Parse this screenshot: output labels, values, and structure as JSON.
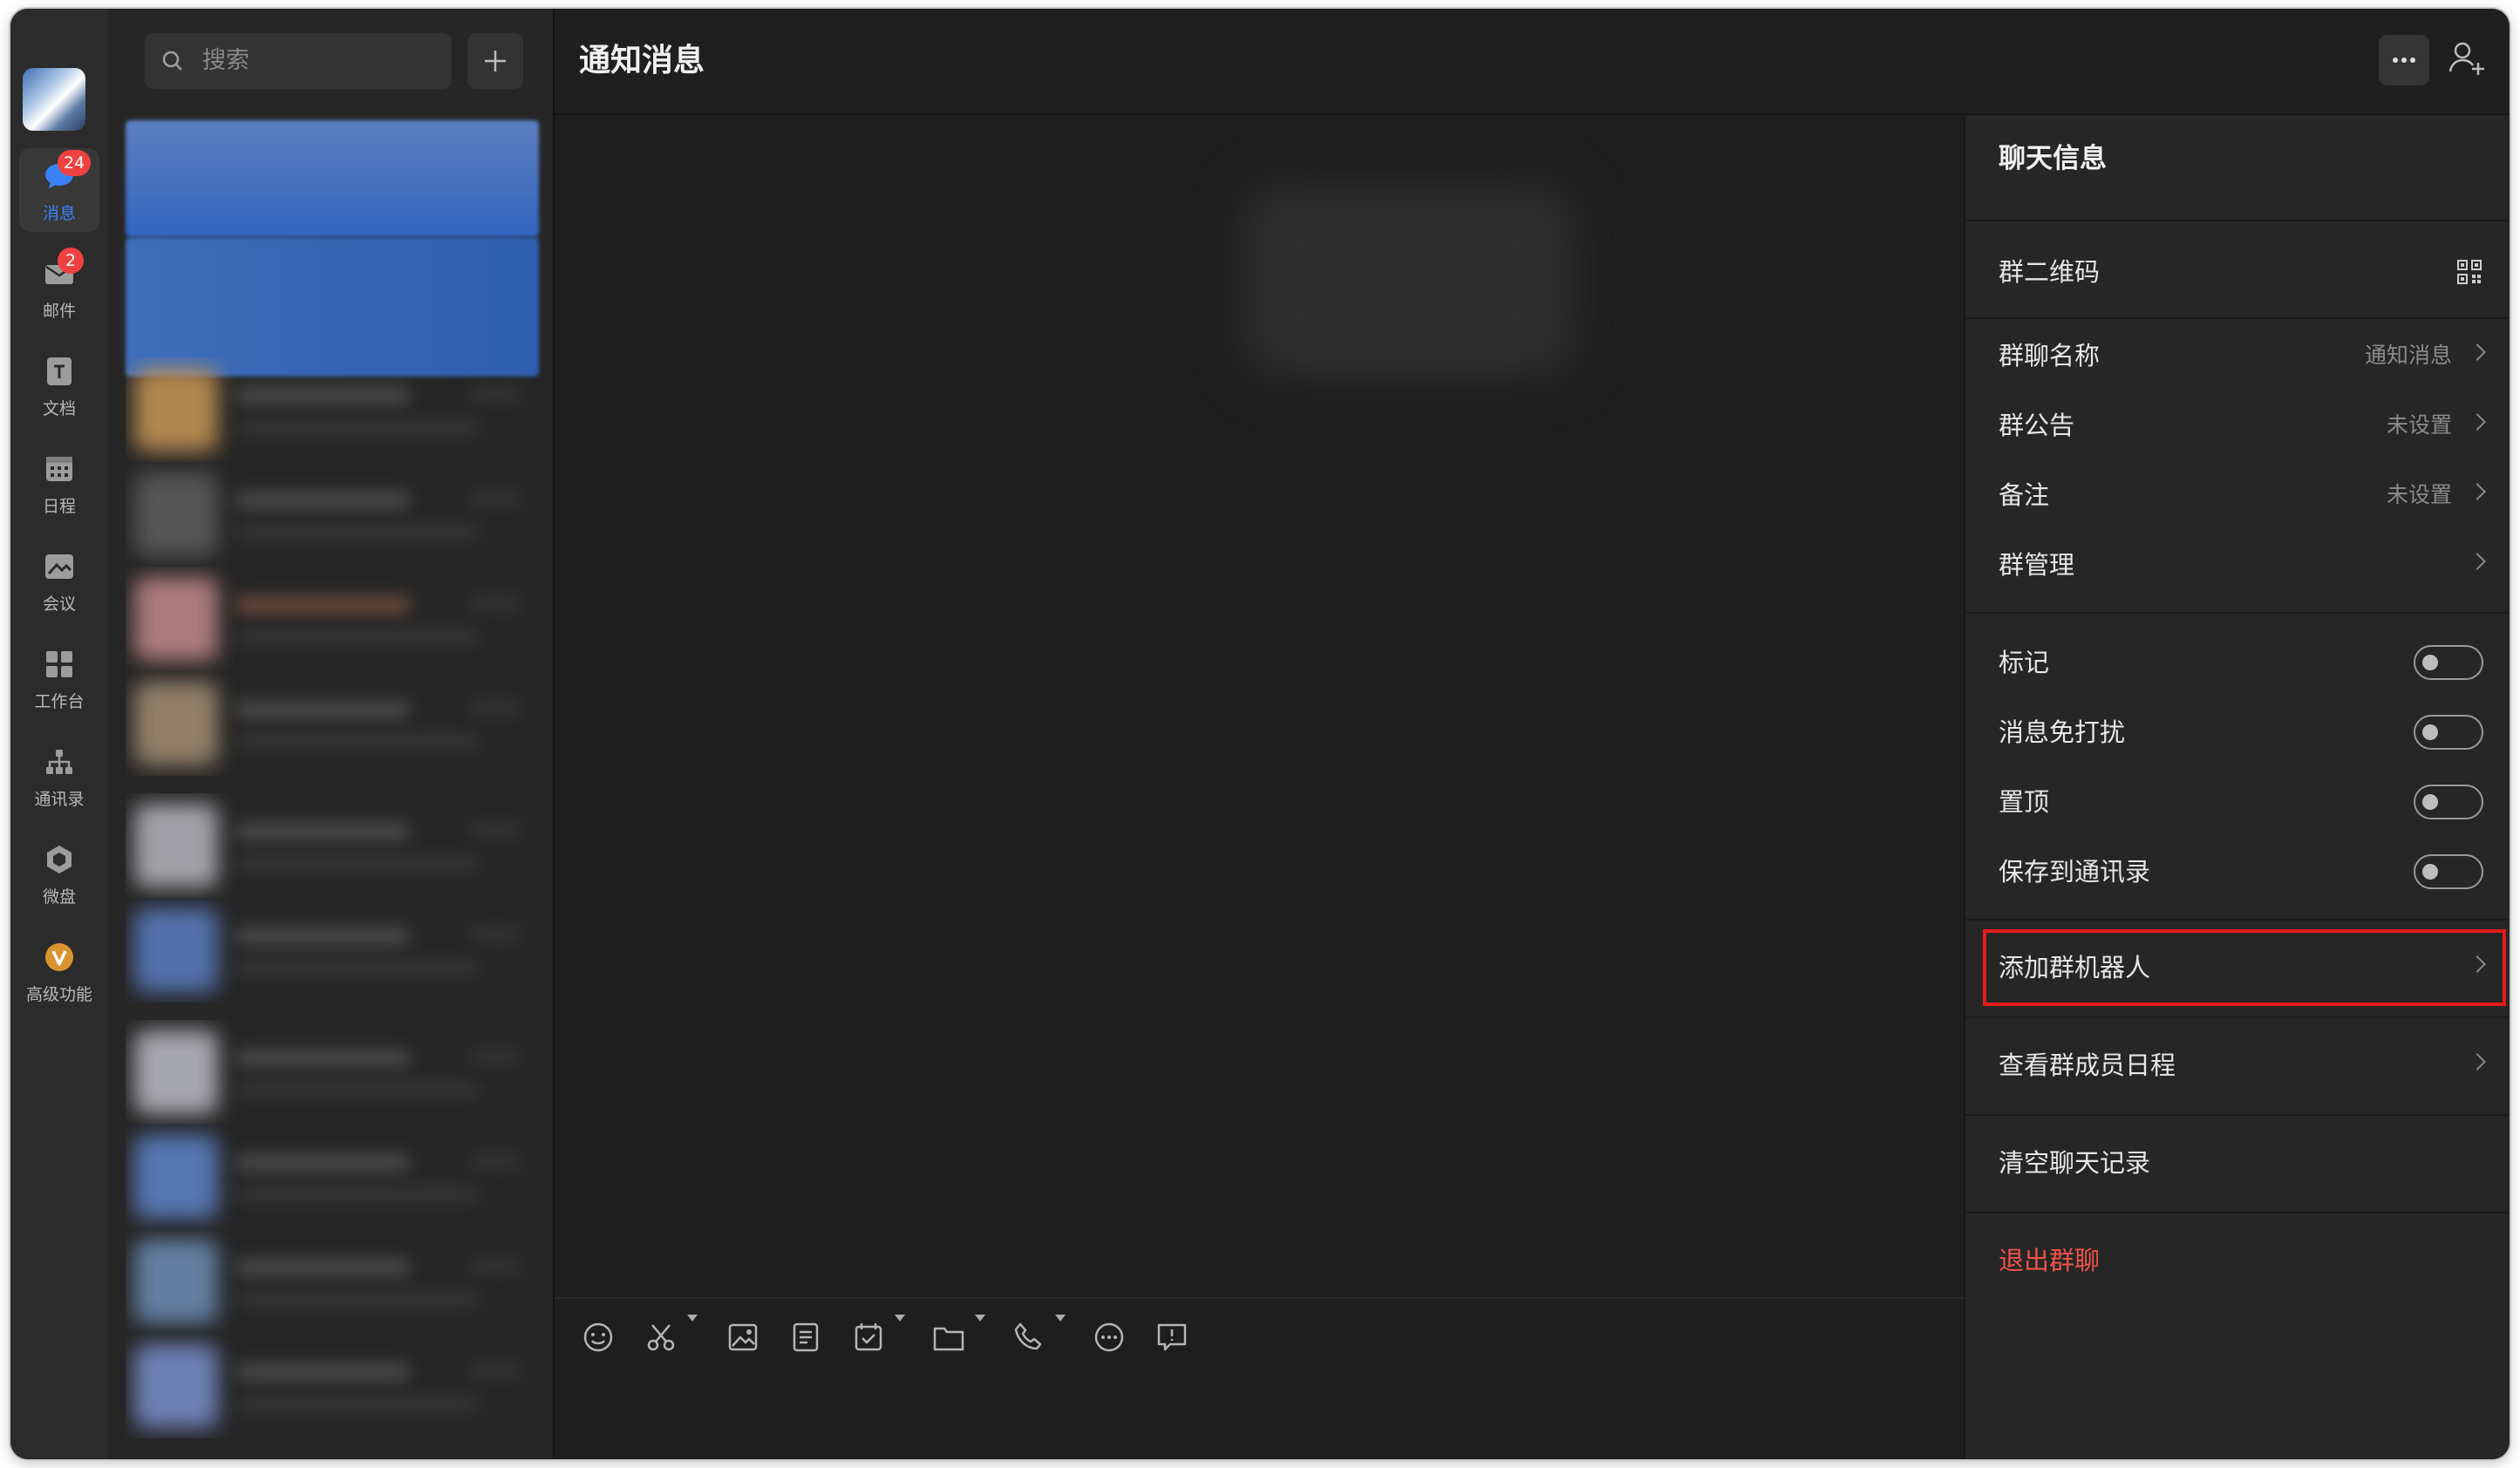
{
  "nav": {
    "items": [
      {
        "label": "消息",
        "badge": "24",
        "icon": "chat-bubble-icon",
        "active": true
      },
      {
        "label": "邮件",
        "badge": "2",
        "icon": "mail-icon"
      },
      {
        "label": "文档",
        "icon": "document-icon"
      },
      {
        "label": "日程",
        "icon": "calendar-icon"
      },
      {
        "label": "会议",
        "icon": "meeting-icon"
      },
      {
        "label": "工作台",
        "icon": "workbench-icon"
      },
      {
        "label": "通讯录",
        "icon": "contacts-icon"
      },
      {
        "label": "微盘",
        "icon": "drive-icon"
      },
      {
        "label": "高级功能",
        "icon": "premium-icon"
      }
    ]
  },
  "search": {
    "placeholder": "搜索"
  },
  "chat": {
    "title": "通知消息"
  },
  "panel": {
    "title": "聊天信息",
    "qr_label": "群二维码",
    "group_name": {
      "label": "群聊名称",
      "value": "通知消息"
    },
    "announcement": {
      "label": "群公告",
      "value": "未设置"
    },
    "remark": {
      "label": "备注",
      "value": "未设置"
    },
    "manage": {
      "label": "群管理"
    },
    "toggles": [
      {
        "label": "标记",
        "on": false
      },
      {
        "label": "消息免打扰",
        "on": false
      },
      {
        "label": "置顶",
        "on": false
      },
      {
        "label": "保存到通讯录",
        "on": false
      }
    ],
    "add_bot": {
      "label": "添加群机器人"
    },
    "member_schedule": {
      "label": "查看群成员日程"
    },
    "clear_history": {
      "label": "清空聊天记录"
    },
    "leave_group": {
      "label": "退出群聊"
    }
  },
  "colors": {
    "accent": "#3b82f6",
    "badge": "#f04141",
    "danger": "#f05349",
    "highlight_box": "#e31b1b"
  }
}
